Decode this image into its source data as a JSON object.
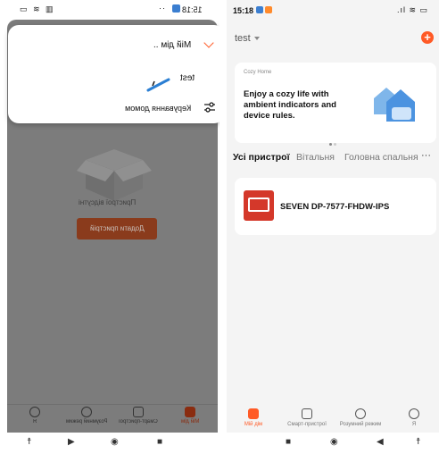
{
  "left_screen": {
    "status": {
      "time": "15:18"
    },
    "dropdown": {
      "title": "Мій дім ..",
      "item": "test",
      "manage": "Керування домом"
    },
    "empty_text": "Пристрої відсутні",
    "add_button": "Додати пристрій",
    "tabs": [
      {
        "label": "Мій дім"
      },
      {
        "label": "Смарт-пристрої"
      },
      {
        "label": "Розумний режим"
      },
      {
        "label": "Я"
      }
    ]
  },
  "right_screen": {
    "status": {
      "time": "15:18"
    },
    "home_selector": "test",
    "banner": {
      "subtitle": "Cozy Home",
      "tagline": "Enjoy a cozy life with ambient indicators and device rules."
    },
    "room_tabs": [
      "Усі пристрої",
      "Вітальня",
      "Головна спальня"
    ],
    "more_label": "···",
    "device": {
      "name": "SEVEN DP-7577-FHDW-IPS"
    },
    "tabs": [
      {
        "label": "Мій дім"
      },
      {
        "label": "Смарт-пристрої"
      },
      {
        "label": "Розумний режим"
      },
      {
        "label": "Я"
      }
    ]
  },
  "colors": {
    "accent": "#ff5a26",
    "device_icon": "#d4382a",
    "overlay": "#7c7c7c"
  }
}
